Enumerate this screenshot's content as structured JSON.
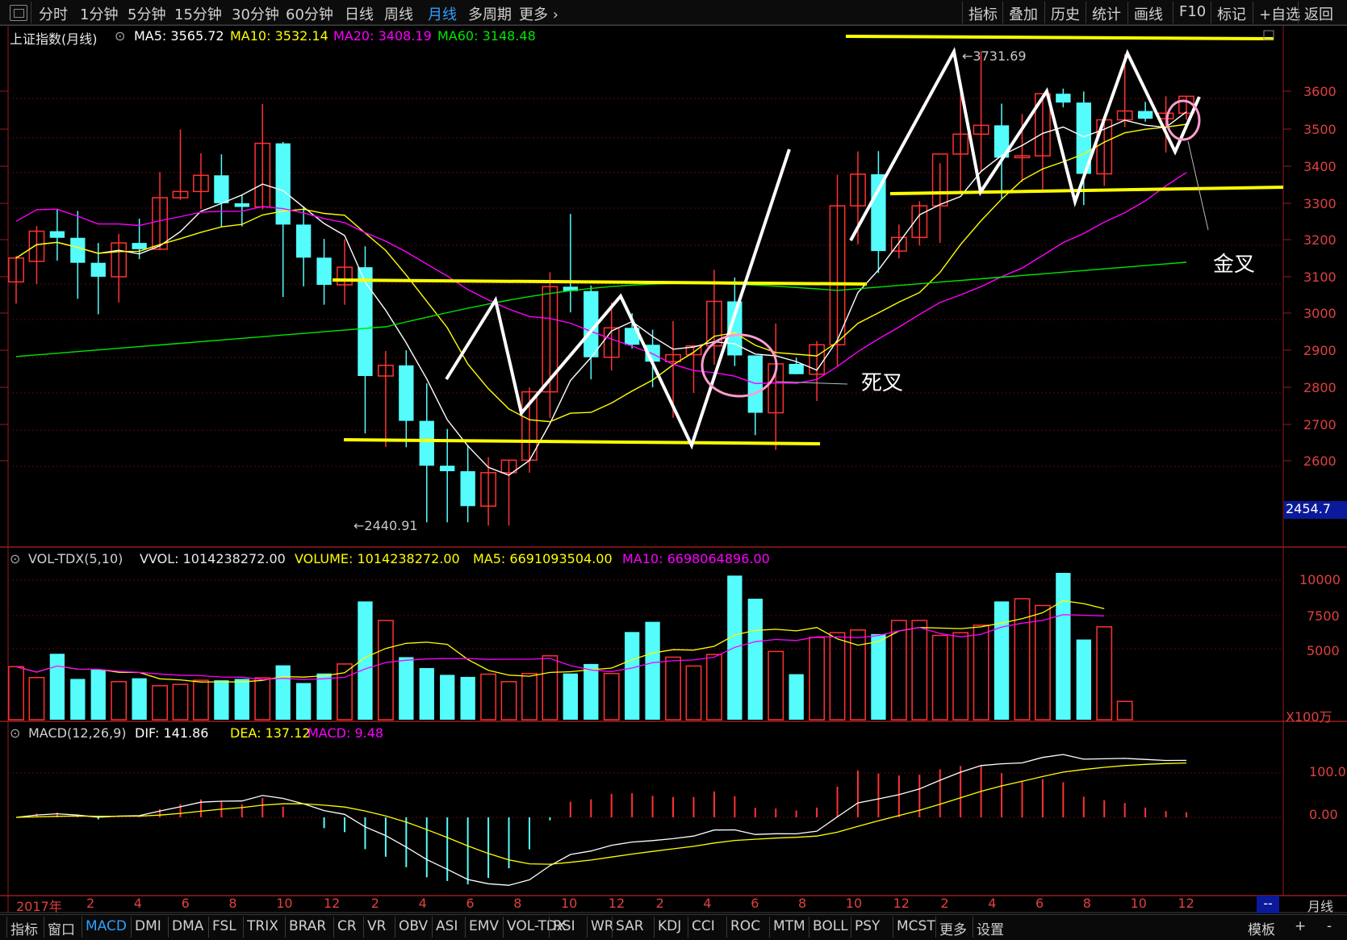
{
  "toolbar": {
    "left": [
      "分时",
      "1分钟",
      "5分钟",
      "15分钟",
      "30分钟",
      "60分钟",
      "日线",
      "周线",
      "月线",
      "多周期",
      "更多 ›"
    ],
    "active": "月线",
    "right": [
      "指标",
      "叠加",
      "历史",
      "统计",
      "画线",
      "F10",
      "标记",
      "+自选",
      "返回"
    ]
  },
  "main_header": {
    "name": "上证指数(月线)",
    "ma5": "MA5: 3565.72",
    "ma10": "MA10: 3532.14",
    "ma20": "MA20: 3408.19",
    "ma60": "MA60: 3148.48"
  },
  "price_axis": [
    "3600",
    "3500",
    "3400",
    "3300",
    "3200",
    "3100",
    "3000",
    "2900",
    "2800",
    "2700",
    "2600"
  ],
  "price_box": "2454.7",
  "annotations": {
    "high": "3731.69",
    "low": "2440.91",
    "dead_cross": "死叉",
    "golden_cross": "金叉"
  },
  "volume_header": {
    "name": "VOL-TDX(5,10)",
    "vvol": "VVOL: 1014238272.00",
    "volume": "VOLUME: 1014238272.00",
    "ma5": "MA5: 6691093504.00",
    "ma10": "MA10: 6698064896.00"
  },
  "volume_axis": [
    "10000",
    "7500",
    "5000"
  ],
  "volume_unit": "X100万",
  "macd_header": {
    "name": "MACD(12,26,9)",
    "dif": "DIF: 141.86",
    "dea": "DEA: 137.12",
    "macd": "MACD: 9.48"
  },
  "macd_axis": [
    "100.0",
    "0.00"
  ],
  "date_axis": [
    "2017年",
    "2",
    "4",
    "6",
    "8",
    "10",
    "12",
    "2",
    "4",
    "6",
    "8",
    "10",
    "12",
    "2",
    "4",
    "6",
    "8",
    "10",
    "12",
    "2",
    "4",
    "6",
    "8",
    "10",
    "12"
  ],
  "period_label": "月线",
  "period_box": "--",
  "bottom_tabs": [
    "指标",
    "窗口",
    "MACD",
    "DMI",
    "DMA",
    "FSL",
    "TRIX",
    "BRAR",
    "CR",
    "VR",
    "OBV",
    "ASI",
    "EMV",
    "VOL-TDX",
    "RSI",
    "WR",
    "SAR",
    "KDJ",
    "CCI",
    "ROC",
    "MTM",
    "BOLL",
    "PSY",
    "MCST",
    "更多",
    "设置"
  ],
  "bottom_active": "MACD",
  "bottom_right": [
    "模板",
    "+",
    "-"
  ],
  "colors": {
    "up": "#ff3232",
    "down": "#54fcfc",
    "ma5": "#ffffff",
    "ma10": "#ffff00",
    "ma20": "#ff00ff",
    "ma60": "#00e600",
    "axis_text": "#ff3c3c",
    "active_tab": "#2ea0ff"
  },
  "chart_data": {
    "type": "candlestick",
    "period": "monthly",
    "ohlc": [
      [
        3103,
        3174,
        3044,
        3168
      ],
      [
        3159,
        3255,
        3097,
        3241
      ],
      [
        3241,
        3301,
        3161,
        3223
      ],
      [
        3223,
        3296,
        3057,
        3155
      ],
      [
        3155,
        3209,
        3015,
        3117
      ],
      [
        3117,
        3234,
        3047,
        3209
      ],
      [
        3209,
        3275,
        3165,
        3192
      ],
      [
        3192,
        3402,
        3189,
        3332
      ],
      [
        3332,
        3518,
        3326,
        3349
      ],
      [
        3349,
        3453,
        3301,
        3393
      ],
      [
        3393,
        3450,
        3254,
        3317
      ],
      [
        3317,
        3339,
        3254,
        3307
      ],
      [
        3307,
        3587,
        3300,
        3480
      ],
      [
        3480,
        3484,
        3062,
        3259
      ],
      [
        3259,
        3308,
        3091,
        3169
      ],
      [
        3169,
        3220,
        3041,
        3095
      ],
      [
        3095,
        3219,
        3041,
        3143
      ],
      [
        3143,
        3200,
        2691,
        2847
      ],
      [
        2847,
        2915,
        2654,
        2876
      ],
      [
        2876,
        2917,
        2653,
        2725
      ],
      [
        2725,
        2827,
        2449,
        2603
      ],
      [
        2603,
        2703,
        2449,
        2588
      ],
      [
        2588,
        2659,
        2449,
        2493
      ],
      [
        2493,
        2626,
        2440,
        2584
      ],
      [
        2584,
        2618,
        2440,
        2618
      ],
      [
        2618,
        2816,
        2584,
        2804
      ],
      [
        2804,
        3129,
        2733,
        3090
      ],
      [
        3090,
        3288,
        3020,
        3078
      ],
      [
        3078,
        3093,
        2838,
        2898
      ],
      [
        2898,
        3047,
        2862,
        2978
      ],
      [
        2978,
        3018,
        2922,
        2932
      ],
      [
        2932,
        2973,
        2816,
        2886
      ],
      [
        2886,
        2996,
        2733,
        2905
      ],
      [
        2905,
        2925,
        2801,
        2929
      ],
      [
        2929,
        3136,
        2878,
        3050
      ],
      [
        3050,
        3115,
        2874,
        2903
      ],
      [
        2903,
        2880,
        2686,
        2747
      ],
      [
        2747,
        2990,
        2646,
        2880
      ],
      [
        2880,
        2897,
        2852,
        2852
      ],
      [
        2852,
        2942,
        2779,
        2932
      ],
      [
        2932,
        3395,
        2874,
        3310
      ],
      [
        3310,
        3458,
        3205,
        3396
      ],
      [
        3396,
        3459,
        3127,
        3187
      ],
      [
        3187,
        3259,
        3167,
        3224
      ],
      [
        3224,
        3323,
        3202,
        3310
      ],
      [
        3310,
        3426,
        3209,
        3451
      ],
      [
        3451,
        3623,
        3345,
        3505
      ],
      [
        3505,
        3731,
        3405,
        3529
      ],
      [
        3529,
        3588,
        3328,
        3441
      ],
      [
        3441,
        3560,
        3375,
        3446
      ],
      [
        3446,
        3611,
        3348,
        3615
      ],
      [
        3615,
        3629,
        3578,
        3591
      ],
      [
        3591,
        3621,
        3312,
        3397
      ],
      [
        3397,
        3545,
        3364,
        3544
      ],
      [
        3544,
        3723,
        3524,
        3568
      ],
      [
        3568,
        3593,
        3539,
        3547
      ],
      [
        3547,
        3608,
        3455,
        3562
      ],
      [
        3562,
        3608,
        3544,
        3608
      ]
    ],
    "high_label": 3731.69,
    "low_label": 2440.91,
    "volume_unit": "X100万",
    "volume": [
      3900,
      3100,
      4850,
      3000,
      3700,
      2800,
      3050,
      2500,
      2600,
      2900,
      2900,
      3000,
      3080,
      4000,
      2700,
      3400,
      4100,
      8700,
      7300,
      4600,
      3800,
      3300,
      3150,
      3350,
      2800,
      3400,
      4700,
      3400,
      4100,
      3400,
      6450,
      7200,
      4600,
      3950,
      4800,
      10600,
      8900,
      5020,
      3350,
      6050,
      6400,
      6600,
      6300,
      7300,
      7300,
      6200,
      6400,
      6950,
      8700,
      8900,
      8400,
      10800,
      5900,
      6830,
      1350
    ],
    "ma_series_note": "",
    "macd": {
      "dif_last": 141.86,
      "dea_last": 137.12,
      "macd_last": 9.48
    }
  }
}
